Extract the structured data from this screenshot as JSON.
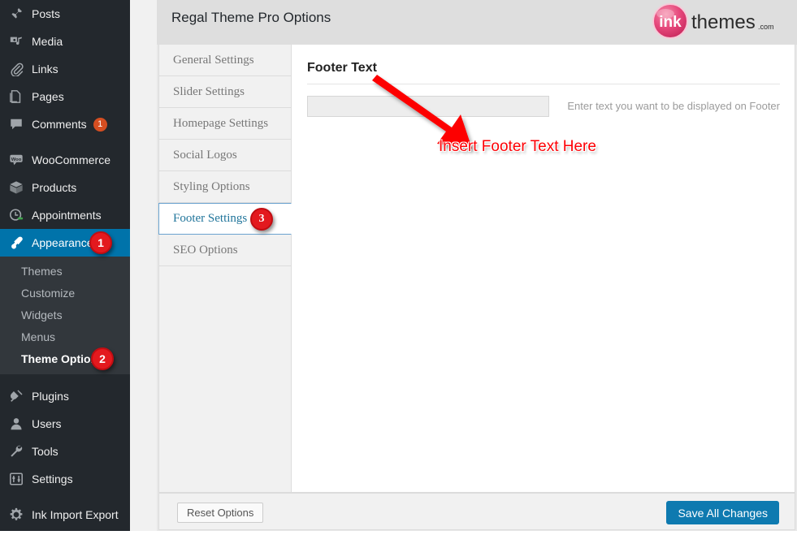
{
  "sidebar": {
    "items": [
      {
        "label": "Posts",
        "icon": "pushpin-icon",
        "current": false
      },
      {
        "label": "Media",
        "icon": "media-icon",
        "current": false
      },
      {
        "label": "Links",
        "icon": "paperclip-icon",
        "current": false
      },
      {
        "label": "Pages",
        "icon": "pages-icon",
        "current": false
      },
      {
        "label": "Comments",
        "icon": "comment-icon",
        "current": false,
        "count": "1"
      },
      {
        "label": "WooCommerce",
        "icon": "woocommerce-icon",
        "current": false,
        "gap_before": true
      },
      {
        "label": "Products",
        "icon": "products-box-icon",
        "current": false
      },
      {
        "label": "Appointments",
        "icon": "appointments-icon",
        "current": false
      },
      {
        "label": "Appearance",
        "icon": "appearance-brush-icon",
        "current": true,
        "step": "1"
      },
      {
        "label": "Plugins",
        "icon": "plugins-plug-icon",
        "current": false,
        "gap_before": true
      },
      {
        "label": "Users",
        "icon": "users-icon",
        "current": false
      },
      {
        "label": "Tools",
        "icon": "tools-wrench-icon",
        "current": false
      },
      {
        "label": "Settings",
        "icon": "settings-sliders-icon",
        "current": false
      },
      {
        "label": "Ink Import Export",
        "icon": "gear-icon",
        "current": false,
        "gap_before": true
      }
    ],
    "submenu": [
      {
        "label": "Themes",
        "current": false
      },
      {
        "label": "Customize",
        "current": false
      },
      {
        "label": "Widgets",
        "current": false
      },
      {
        "label": "Menus",
        "current": false
      },
      {
        "label": "Theme Options",
        "current": true,
        "step": "2"
      }
    ]
  },
  "header": {
    "title": "Regal Theme Pro Options",
    "logo_mark": "ink",
    "logo_word": "themes",
    "logo_tld": ".com"
  },
  "tabs": [
    {
      "label": "General Settings",
      "active": false
    },
    {
      "label": "Slider Settings",
      "active": false
    },
    {
      "label": "Homepage Settings",
      "active": false
    },
    {
      "label": "Social Logos",
      "active": false
    },
    {
      "label": "Styling Options",
      "active": false
    },
    {
      "label": "Footer Settings",
      "active": true,
      "step": "3"
    },
    {
      "label": "SEO Options",
      "active": false
    }
  ],
  "content": {
    "section_title": "Footer Text",
    "footer_text_value": "",
    "footer_text_placeholder": "",
    "footer_text_hint": "Enter text you want to be displayed on Footer"
  },
  "footer_bar": {
    "reset_label": "Reset Options",
    "save_label": "Save All Changes"
  },
  "annotations": {
    "callout_text": "Insert Footer Text Here",
    "arrow_color": "#fd0005"
  },
  "colors": {
    "admin_bg": "#23282d",
    "submenu_bg": "#32373c",
    "current_blue": "#0073aa",
    "save_blue": "#0e7ab0",
    "step_red": "#e3191e",
    "bubble_orange": "#d54e21",
    "logo_pink": "#e5467a"
  }
}
